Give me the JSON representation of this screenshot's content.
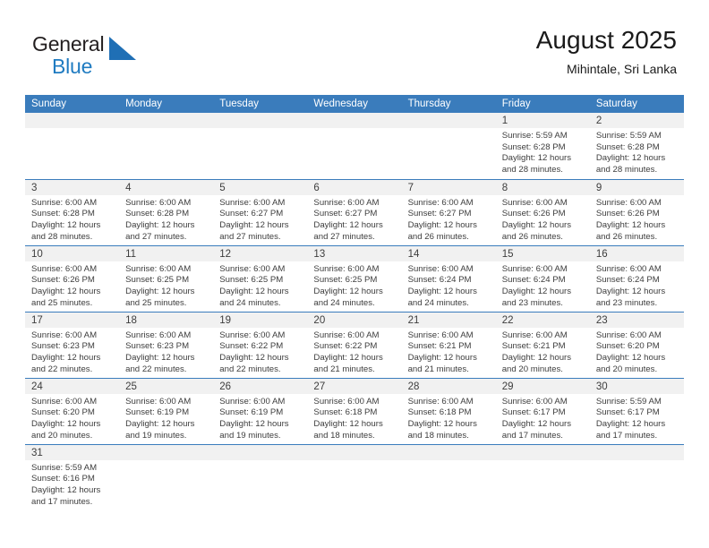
{
  "brand": {
    "name_part1": "General",
    "name_part2": "Blue",
    "mark_icon": "blue-triangle-logo-icon",
    "color_dark": "#231f20",
    "color_blue": "#1f7bc1"
  },
  "header": {
    "title": "August 2025",
    "subtitle": "Mihintale, Sri Lanka"
  },
  "theme": {
    "header_bg": "#3a7cbc",
    "daynum_band_bg": "#f1f1f1",
    "row_separator": "#3a7cbc",
    "text": "#3d3d3d"
  },
  "columns": [
    "Sunday",
    "Monday",
    "Tuesday",
    "Wednesday",
    "Thursday",
    "Friday",
    "Saturday"
  ],
  "weeks": [
    [
      {
        "day": "",
        "lines": []
      },
      {
        "day": "",
        "lines": []
      },
      {
        "day": "",
        "lines": []
      },
      {
        "day": "",
        "lines": []
      },
      {
        "day": "",
        "lines": []
      },
      {
        "day": "1",
        "lines": [
          "Sunrise: 5:59 AM",
          "Sunset: 6:28 PM",
          "Daylight: 12 hours",
          "and 28 minutes."
        ]
      },
      {
        "day": "2",
        "lines": [
          "Sunrise: 5:59 AM",
          "Sunset: 6:28 PM",
          "Daylight: 12 hours",
          "and 28 minutes."
        ]
      }
    ],
    [
      {
        "day": "3",
        "lines": [
          "Sunrise: 6:00 AM",
          "Sunset: 6:28 PM",
          "Daylight: 12 hours",
          "and 28 minutes."
        ]
      },
      {
        "day": "4",
        "lines": [
          "Sunrise: 6:00 AM",
          "Sunset: 6:28 PM",
          "Daylight: 12 hours",
          "and 27 minutes."
        ]
      },
      {
        "day": "5",
        "lines": [
          "Sunrise: 6:00 AM",
          "Sunset: 6:27 PM",
          "Daylight: 12 hours",
          "and 27 minutes."
        ]
      },
      {
        "day": "6",
        "lines": [
          "Sunrise: 6:00 AM",
          "Sunset: 6:27 PM",
          "Daylight: 12 hours",
          "and 27 minutes."
        ]
      },
      {
        "day": "7",
        "lines": [
          "Sunrise: 6:00 AM",
          "Sunset: 6:27 PM",
          "Daylight: 12 hours",
          "and 26 minutes."
        ]
      },
      {
        "day": "8",
        "lines": [
          "Sunrise: 6:00 AM",
          "Sunset: 6:26 PM",
          "Daylight: 12 hours",
          "and 26 minutes."
        ]
      },
      {
        "day": "9",
        "lines": [
          "Sunrise: 6:00 AM",
          "Sunset: 6:26 PM",
          "Daylight: 12 hours",
          "and 26 minutes."
        ]
      }
    ],
    [
      {
        "day": "10",
        "lines": [
          "Sunrise: 6:00 AM",
          "Sunset: 6:26 PM",
          "Daylight: 12 hours",
          "and 25 minutes."
        ]
      },
      {
        "day": "11",
        "lines": [
          "Sunrise: 6:00 AM",
          "Sunset: 6:25 PM",
          "Daylight: 12 hours",
          "and 25 minutes."
        ]
      },
      {
        "day": "12",
        "lines": [
          "Sunrise: 6:00 AM",
          "Sunset: 6:25 PM",
          "Daylight: 12 hours",
          "and 24 minutes."
        ]
      },
      {
        "day": "13",
        "lines": [
          "Sunrise: 6:00 AM",
          "Sunset: 6:25 PM",
          "Daylight: 12 hours",
          "and 24 minutes."
        ]
      },
      {
        "day": "14",
        "lines": [
          "Sunrise: 6:00 AM",
          "Sunset: 6:24 PM",
          "Daylight: 12 hours",
          "and 24 minutes."
        ]
      },
      {
        "day": "15",
        "lines": [
          "Sunrise: 6:00 AM",
          "Sunset: 6:24 PM",
          "Daylight: 12 hours",
          "and 23 minutes."
        ]
      },
      {
        "day": "16",
        "lines": [
          "Sunrise: 6:00 AM",
          "Sunset: 6:24 PM",
          "Daylight: 12 hours",
          "and 23 minutes."
        ]
      }
    ],
    [
      {
        "day": "17",
        "lines": [
          "Sunrise: 6:00 AM",
          "Sunset: 6:23 PM",
          "Daylight: 12 hours",
          "and 22 minutes."
        ]
      },
      {
        "day": "18",
        "lines": [
          "Sunrise: 6:00 AM",
          "Sunset: 6:23 PM",
          "Daylight: 12 hours",
          "and 22 minutes."
        ]
      },
      {
        "day": "19",
        "lines": [
          "Sunrise: 6:00 AM",
          "Sunset: 6:22 PM",
          "Daylight: 12 hours",
          "and 22 minutes."
        ]
      },
      {
        "day": "20",
        "lines": [
          "Sunrise: 6:00 AM",
          "Sunset: 6:22 PM",
          "Daylight: 12 hours",
          "and 21 minutes."
        ]
      },
      {
        "day": "21",
        "lines": [
          "Sunrise: 6:00 AM",
          "Sunset: 6:21 PM",
          "Daylight: 12 hours",
          "and 21 minutes."
        ]
      },
      {
        "day": "22",
        "lines": [
          "Sunrise: 6:00 AM",
          "Sunset: 6:21 PM",
          "Daylight: 12 hours",
          "and 20 minutes."
        ]
      },
      {
        "day": "23",
        "lines": [
          "Sunrise: 6:00 AM",
          "Sunset: 6:20 PM",
          "Daylight: 12 hours",
          "and 20 minutes."
        ]
      }
    ],
    [
      {
        "day": "24",
        "lines": [
          "Sunrise: 6:00 AM",
          "Sunset: 6:20 PM",
          "Daylight: 12 hours",
          "and 20 minutes."
        ]
      },
      {
        "day": "25",
        "lines": [
          "Sunrise: 6:00 AM",
          "Sunset: 6:19 PM",
          "Daylight: 12 hours",
          "and 19 minutes."
        ]
      },
      {
        "day": "26",
        "lines": [
          "Sunrise: 6:00 AM",
          "Sunset: 6:19 PM",
          "Daylight: 12 hours",
          "and 19 minutes."
        ]
      },
      {
        "day": "27",
        "lines": [
          "Sunrise: 6:00 AM",
          "Sunset: 6:18 PM",
          "Daylight: 12 hours",
          "and 18 minutes."
        ]
      },
      {
        "day": "28",
        "lines": [
          "Sunrise: 6:00 AM",
          "Sunset: 6:18 PM",
          "Daylight: 12 hours",
          "and 18 minutes."
        ]
      },
      {
        "day": "29",
        "lines": [
          "Sunrise: 6:00 AM",
          "Sunset: 6:17 PM",
          "Daylight: 12 hours",
          "and 17 minutes."
        ]
      },
      {
        "day": "30",
        "lines": [
          "Sunrise: 5:59 AM",
          "Sunset: 6:17 PM",
          "Daylight: 12 hours",
          "and 17 minutes."
        ]
      }
    ],
    [
      {
        "day": "31",
        "lines": [
          "Sunrise: 5:59 AM",
          "Sunset: 6:16 PM",
          "Daylight: 12 hours",
          "and 17 minutes."
        ]
      },
      {
        "day": "",
        "lines": []
      },
      {
        "day": "",
        "lines": []
      },
      {
        "day": "",
        "lines": []
      },
      {
        "day": "",
        "lines": []
      },
      {
        "day": "",
        "lines": []
      },
      {
        "day": "",
        "lines": []
      }
    ]
  ]
}
